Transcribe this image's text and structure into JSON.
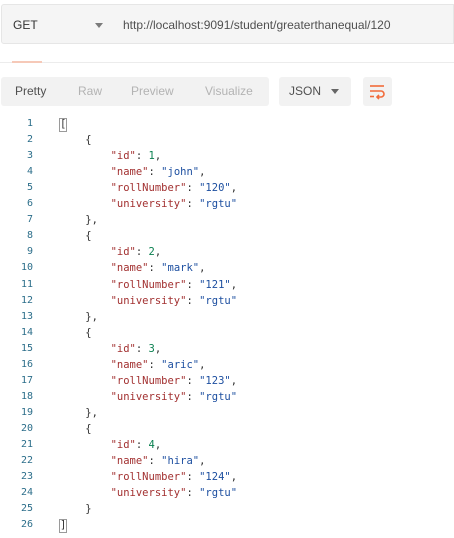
{
  "request": {
    "method": "GET",
    "url": "http://localhost:9091/student/greaterthanequal/120"
  },
  "toolbar": {
    "views": [
      "Pretty",
      "Raw",
      "Preview",
      "Visualize"
    ],
    "active_view": "Pretty",
    "format": "JSON",
    "wrap_icon": "wrap-lines-icon",
    "accent_color": "#f26b3a"
  },
  "response": {
    "line_numbers": [
      "1",
      "2",
      "3",
      "4",
      "5",
      "6",
      "7",
      "8",
      "9",
      "10",
      "11",
      "12",
      "13",
      "14",
      "15",
      "16",
      "17",
      "18",
      "19",
      "20",
      "21",
      "22",
      "23",
      "24",
      "25",
      "26"
    ],
    "students": [
      {
        "id": "1",
        "name": "john",
        "rollNumber": "120",
        "university": "rgtu"
      },
      {
        "id": "2",
        "name": "mark",
        "rollNumber": "121",
        "university": "rgtu"
      },
      {
        "id": "3",
        "name": "aric",
        "rollNumber": "123",
        "university": "rgtu"
      },
      {
        "id": "4",
        "name": "hira",
        "rollNumber": "124",
        "university": "rgtu"
      }
    ]
  }
}
